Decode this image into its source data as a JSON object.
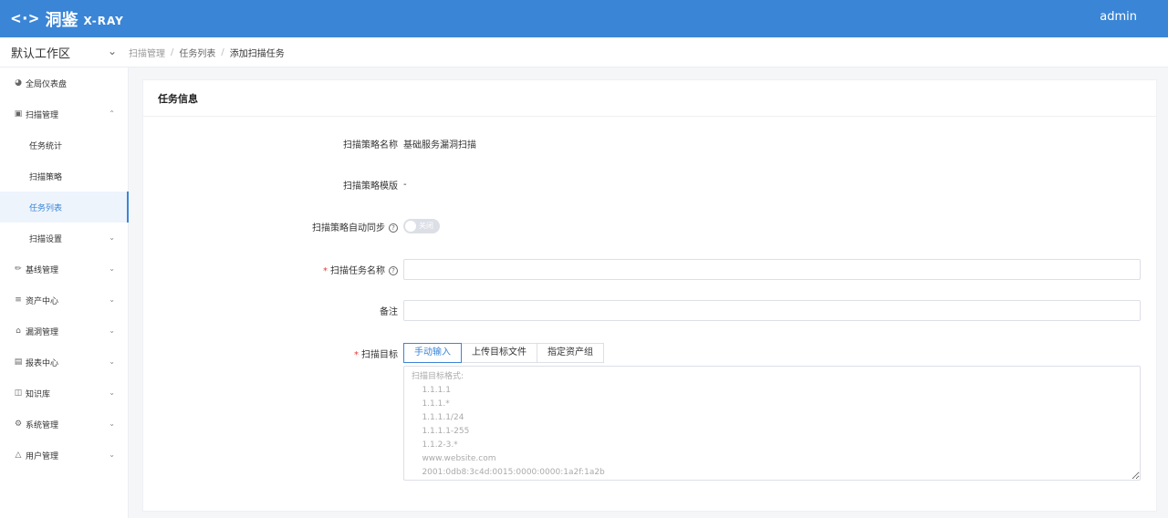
{
  "header": {
    "logo_mark": "<·>",
    "logo_cn": "洞鉴",
    "logo_en": "X-RAY",
    "user": "admin"
  },
  "workspace": {
    "label": "默认工作区"
  },
  "breadcrumb": {
    "items": [
      "扫描管理",
      "任务列表",
      "添加扫描任务"
    ]
  },
  "sidebar": {
    "items": [
      {
        "label": "全局仪表盘",
        "icon": "dashboard-icon"
      },
      {
        "label": "扫描管理",
        "icon": "scan-icon",
        "expanded": true
      },
      {
        "label": "任务统计"
      },
      {
        "label": "扫描策略"
      },
      {
        "label": "任务列表",
        "active": true
      },
      {
        "label": "扫描设置"
      },
      {
        "label": "基线管理",
        "icon": "baseline-icon"
      },
      {
        "label": "资产中心",
        "icon": "layers-icon"
      },
      {
        "label": "漏洞管理",
        "icon": "home-icon"
      },
      {
        "label": "报表中心",
        "icon": "report-icon"
      },
      {
        "label": "知识库",
        "icon": "book-icon"
      },
      {
        "label": "系统管理",
        "icon": "gear-icon"
      },
      {
        "label": "用户管理",
        "icon": "user-icon"
      }
    ]
  },
  "card": {
    "title": "任务信息",
    "fields": {
      "policy_name": {
        "label": "扫描策略名称",
        "value": "基础服务漏洞扫描"
      },
      "policy_template": {
        "label": "扫描策略模版",
        "value": "-"
      },
      "auto_sync": {
        "label": "扫描策略自动同步",
        "toggle_text": "关闭",
        "on": false
      },
      "task_name": {
        "label": "扫描任务名称",
        "value": "",
        "placeholder": ""
      },
      "remark": {
        "label": "备注",
        "value": "",
        "placeholder": ""
      },
      "target": {
        "label": "扫描目标",
        "tabs": [
          "手动输入",
          "上传目标文件",
          "指定资产组"
        ],
        "active_tab": 0,
        "placeholder": "扫描目标格式:\n    1.1.1.1\n    1.1.1.*\n    1.1.1.1/24\n    1.1.1.1-255\n    1.1.2-3.*\n    www.website.com\n    2001:0db8:3c4d:0015:0000:0000:1a2f:1a2b"
      }
    }
  },
  "colors": {
    "primary": "#3a85d6",
    "required": "#e53935"
  }
}
